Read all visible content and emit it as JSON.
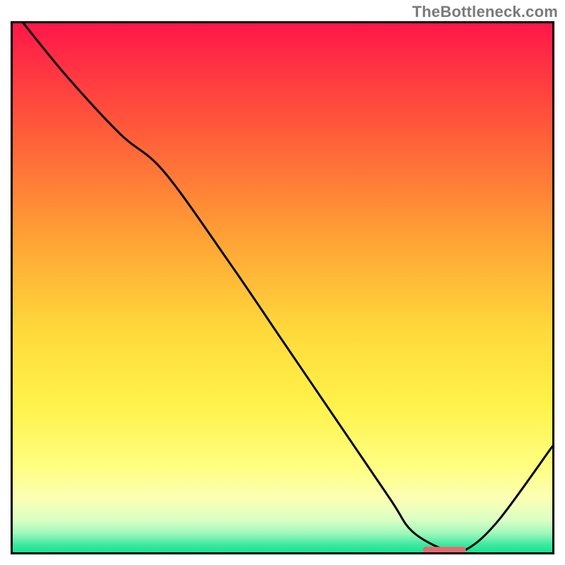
{
  "watermark": "TheBottleneck.com",
  "colors": {
    "frame": "#000000",
    "curve": "#000000",
    "marker_fill": "#e46a6f",
    "gradient_stops": [
      {
        "offset": 0.0,
        "color": "#ff1749"
      },
      {
        "offset": 0.2,
        "color": "#ff5a3a"
      },
      {
        "offset": 0.4,
        "color": "#ffa035"
      },
      {
        "offset": 0.58,
        "color": "#ffd93b"
      },
      {
        "offset": 0.72,
        "color": "#fff24a"
      },
      {
        "offset": 0.84,
        "color": "#ffff82"
      },
      {
        "offset": 0.9,
        "color": "#fbffb4"
      },
      {
        "offset": 0.94,
        "color": "#d9ffc4"
      },
      {
        "offset": 0.965,
        "color": "#9cf7ba"
      },
      {
        "offset": 0.985,
        "color": "#3ee9a1"
      },
      {
        "offset": 1.0,
        "color": "#18e38f"
      }
    ]
  },
  "chart_data": {
    "type": "line",
    "title": "",
    "xlabel": "",
    "ylabel": "",
    "xlim": [
      0,
      100
    ],
    "ylim": [
      0,
      100
    ],
    "series": [
      {
        "name": "bottleneck-curve",
        "x": [
          2,
          10,
          20,
          28,
          40,
          50,
          60,
          70,
          74,
          80,
          84,
          90,
          100
        ],
        "y": [
          100,
          90,
          79,
          72,
          55,
          40,
          25,
          10,
          4,
          0.5,
          0.5,
          6,
          20
        ]
      }
    ],
    "annotations": [
      {
        "name": "optimal-range-marker",
        "x_start": 76,
        "x_end": 84,
        "y": 0.5
      }
    ]
  }
}
